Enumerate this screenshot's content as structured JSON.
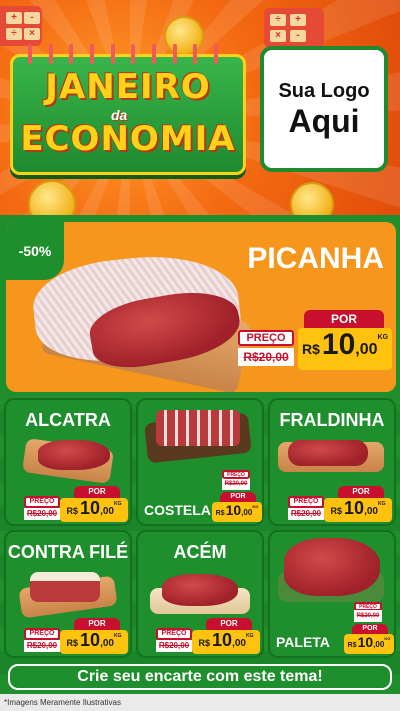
{
  "header": {
    "banner_line1": "JANEIRO",
    "banner_da": "da",
    "banner_line2": "ECONOMIA",
    "logo_line1": "Sua Logo",
    "logo_line2": "Aqui"
  },
  "hero": {
    "discount": "-50%",
    "name": "PICANHA",
    "preco_label": "PREÇO",
    "old_price": "R$20,00",
    "por_label": "POR",
    "currency": "R$",
    "price_int": "10",
    "price_dec": ",00",
    "unit": "KG"
  },
  "products": [
    {
      "name": "ALCATRA",
      "preco_label": "PREÇO",
      "old_price": "R$20,00",
      "por_label": "POR",
      "currency": "R$",
      "price_int": "10",
      "price_dec": ",00",
      "unit": "KG"
    },
    {
      "name": "COSTELA",
      "preco_label": "PREÇO",
      "old_price": "R$20,00",
      "por_label": "POR",
      "currency": "R$",
      "price_int": "10",
      "price_dec": ",00",
      "unit": "KG"
    },
    {
      "name": "FRALDINHA",
      "preco_label": "PREÇO",
      "old_price": "R$20,00",
      "por_label": "POR",
      "currency": "R$",
      "price_int": "10",
      "price_dec": ",00",
      "unit": "KG"
    },
    {
      "name": "CONTRA FILÉ",
      "preco_label": "PREÇO",
      "old_price": "R$20,00",
      "por_label": "POR",
      "currency": "R$",
      "price_int": "10",
      "price_dec": ",00",
      "unit": "KG"
    },
    {
      "name": "ACÉM",
      "preco_label": "PREÇO",
      "old_price": "R$20,00",
      "por_label": "POR",
      "currency": "R$",
      "price_int": "10",
      "price_dec": ",00",
      "unit": "KG"
    },
    {
      "name": "PALETA",
      "preco_label": "PREÇO",
      "old_price": "R$20,00",
      "por_label": "POR",
      "currency": "R$",
      "price_int": "10",
      "price_dec": ",00",
      "unit": "KG"
    }
  ],
  "cta": "Crie seu encarte com este tema!",
  "footnote": "*Imagens Meramente Ilustrativas",
  "colors": {
    "green": "#1e8f2c",
    "orange": "#f7961d",
    "red": "#c8102e",
    "yellow": "#ffc20e"
  }
}
